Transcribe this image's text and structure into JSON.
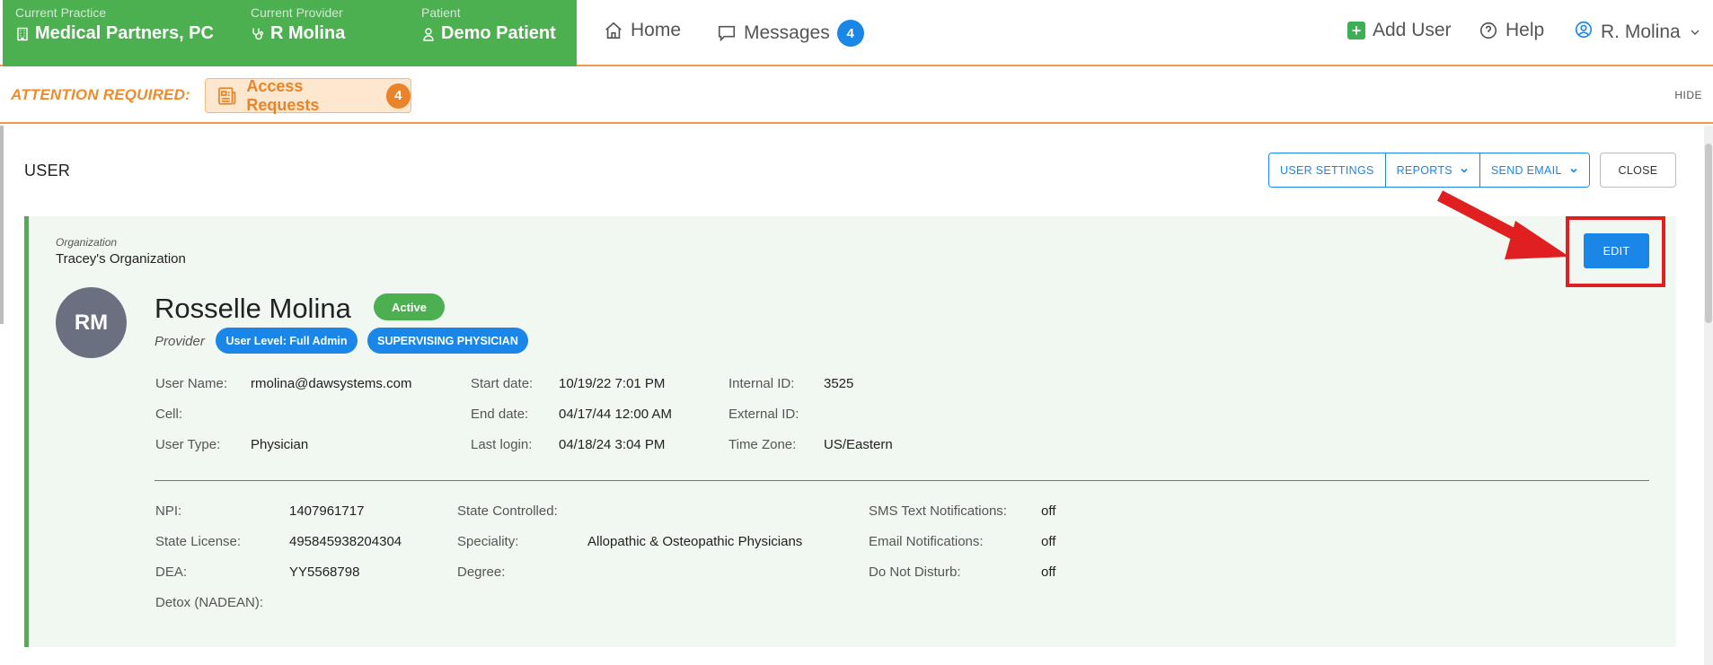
{
  "topbar": {
    "practice_label": "Current Practice",
    "practice_value": "Medical Partners, PC",
    "provider_label": "Current Provider",
    "provider_value": "R Molina",
    "patient_label": "Patient",
    "patient_value": "Demo Patient",
    "home_label": "Home",
    "messages_label": "Messages",
    "messages_count": "4",
    "add_user_label": "Add User",
    "help_label": "Help",
    "account_label": "R. Molina",
    "colors": {
      "green": "#4cb050",
      "blue": "#1a86e8"
    }
  },
  "attention": {
    "label": "ATTENTION REQUIRED:",
    "access_requests_label": "Access Requests",
    "access_requests_count": "4",
    "hide_label": "HIDE",
    "color": "#f08a2a"
  },
  "panel": {
    "title": "USER",
    "user_settings_label": "USER SETTINGS",
    "reports_label": "REPORTS",
    "send_email_label": "SEND EMAIL",
    "close_label": "CLOSE",
    "edit_label": "EDIT"
  },
  "user": {
    "org_label": "Organization",
    "org_value": "Tracey's Organization",
    "initials": "RM",
    "name": "Rosselle Molina",
    "status": "Active",
    "role": "Provider",
    "level_pill": "User Level: Full Admin",
    "supervising_pill": "SUPERVISING PHYSICIAN"
  },
  "details": {
    "username_label": "User Name:",
    "username_value": "rmolina@dawsystems.com",
    "cell_label": "Cell:",
    "cell_value": "",
    "usertype_label": "User Type:",
    "usertype_value": "Physician",
    "start_label": "Start date:",
    "start_value": "10/19/22 7:01 PM",
    "end_label": "End date:",
    "end_value": "04/17/44 12:00 AM",
    "lastlogin_label": "Last login:",
    "lastlogin_value": "04/18/24 3:04 PM",
    "internal_label": "Internal ID:",
    "internal_value": "3525",
    "external_label": "External ID:",
    "external_value": "",
    "timezone_label": "Time Zone:",
    "timezone_value": "US/Eastern"
  },
  "credentials": {
    "npi_label": "NPI:",
    "npi_value": "1407961717",
    "license_label": "State License:",
    "license_value": "495845938204304",
    "dea_label": "DEA:",
    "dea_value": "YY5568798",
    "detox_label": "Detox (NADEAN):",
    "detox_value": "",
    "controlled_label": "State Controlled:",
    "controlled_value": "",
    "speciality_label": "Speciality:",
    "speciality_value": "Allopathic & Osteopathic Physicians",
    "degree_label": "Degree:",
    "degree_value": "",
    "sms_label": "SMS Text Notifications:",
    "sms_value": "off",
    "email_label": "Email Notifications:",
    "email_value": "off",
    "dnd_label": "Do Not Disturb:",
    "dnd_value": "off"
  }
}
